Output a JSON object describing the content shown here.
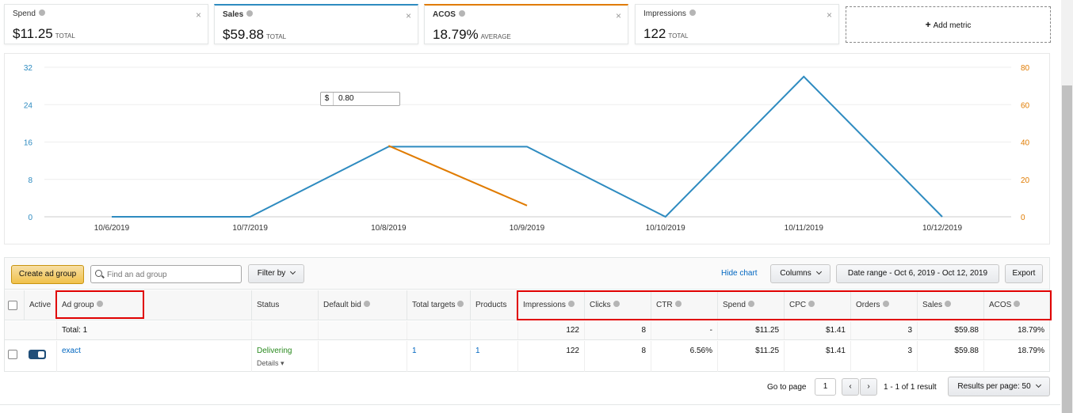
{
  "metrics": [
    {
      "label": "Spend",
      "value": "$11.25",
      "unit": "TOTAL",
      "selected": false,
      "accent": ""
    },
    {
      "label": "Sales",
      "value": "$59.88",
      "unit": "TOTAL",
      "selected": true,
      "accent": "#2e8bc0"
    },
    {
      "label": "ACOS",
      "value": "18.79%",
      "unit": "AVERAGE",
      "selected": true,
      "accent": "#e07b00"
    },
    {
      "label": "Impressions",
      "value": "122",
      "unit": "TOTAL",
      "selected": false,
      "accent": ""
    }
  ],
  "add_metric_label": "Add metric",
  "chart_data": {
    "type": "line",
    "categories": [
      "10/6/2019",
      "10/7/2019",
      "10/8/2019",
      "10/9/2019",
      "10/10/2019",
      "10/11/2019",
      "10/12/2019"
    ],
    "series": [
      {
        "name": "Sales",
        "color": "#2e8bc0",
        "axis": "left",
        "values": [
          0,
          0,
          15,
          15,
          0,
          30,
          0
        ]
      },
      {
        "name": "ACOS",
        "color": "#e07b00",
        "axis": "right",
        "values": [
          null,
          null,
          38,
          6,
          null,
          null,
          null
        ]
      }
    ],
    "y_left": {
      "ticks": [
        "32",
        "24",
        "16",
        "8",
        "0"
      ],
      "range": [
        0,
        32
      ],
      "color": "#2e8bc0"
    },
    "y_right": {
      "ticks": [
        "80",
        "60",
        "40",
        "20",
        "0"
      ],
      "range": [
        0,
        80
      ],
      "color": "#e07b00"
    },
    "grid": true
  },
  "toolbar": {
    "create_label": "Create ad group",
    "search_placeholder": "Find an ad group",
    "filter_label": "Filter by",
    "hide_chart_label": "Hide chart",
    "columns_label": "Columns",
    "date_range_label": "Date range - Oct 6, 2019 - Oct 12, 2019",
    "export_label": "Export"
  },
  "table": {
    "headers": {
      "active": "Active",
      "ad_group": "Ad group",
      "status": "Status",
      "default_bid": "Default bid",
      "total_targets": "Total targets",
      "products": "Products",
      "impressions": "Impressions",
      "clicks": "Clicks",
      "ctr": "CTR",
      "spend": "Spend",
      "cpc": "CPC",
      "orders": "Orders",
      "sales": "Sales",
      "acos": "ACOS"
    },
    "total": {
      "label": "Total: 1",
      "impressions": "122",
      "clicks": "8",
      "ctr": "-",
      "spend": "$11.25",
      "cpc": "$1.41",
      "orders": "3",
      "sales": "$59.88",
      "acos": "18.79%"
    },
    "rows": [
      {
        "ad_group": "exact",
        "status": "Delivering",
        "details": "Details",
        "bid_currency": "$",
        "bid": "0.80",
        "total_targets": "1",
        "products": "1",
        "impressions": "122",
        "clicks": "8",
        "ctr": "6.56%",
        "spend": "$11.25",
        "cpc": "$1.41",
        "orders": "3",
        "sales": "$59.88",
        "acos": "18.79%"
      }
    ]
  },
  "pagination": {
    "go_to_label": "Go to page",
    "page": "1",
    "results_text": "1 - 1 of 1 result",
    "per_page_label": "Results per page: 50"
  }
}
